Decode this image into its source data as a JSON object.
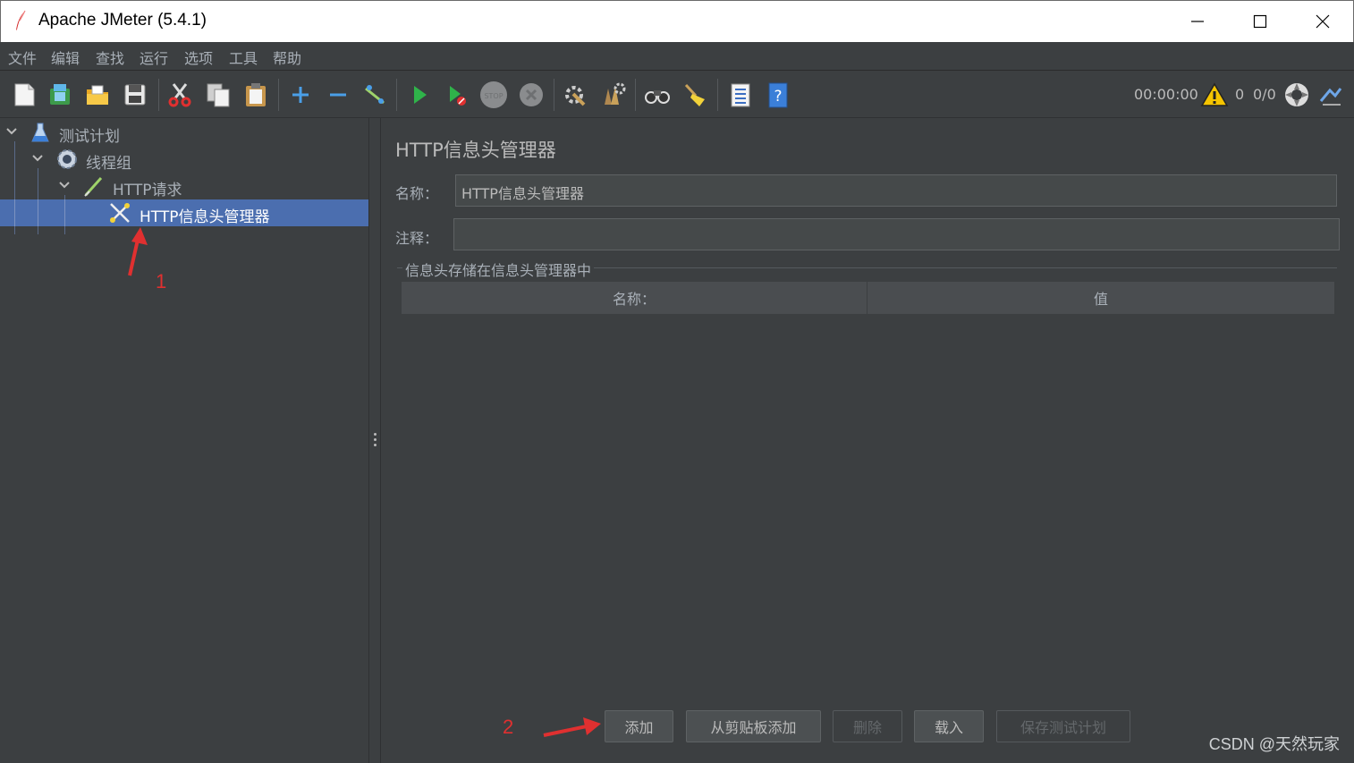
{
  "window": {
    "title": "Apache JMeter (5.4.1)"
  },
  "menu": [
    "文件",
    "编辑",
    "查找",
    "运行",
    "选项",
    "工具",
    "帮助"
  ],
  "toolbar": {
    "icons": [
      "new-icon",
      "templates-icon",
      "open-icon",
      "save-icon",
      "cut-icon",
      "copy-icon",
      "paste-icon",
      "expand-icon",
      "collapse-icon",
      "toggle-icon",
      "start-icon",
      "start-no-pauses-icon",
      "stop-icon",
      "shutdown-icon",
      "clear-icon",
      "clear-all-icon",
      "search-icon",
      "reset-search-icon",
      "function-helper-icon",
      "help-icon"
    ],
    "elapsed_time": "00:00:00",
    "warning_count": "0",
    "threads": "0/0"
  },
  "tree": {
    "nodes": [
      {
        "label": "测试计划",
        "icon": "test-plan-icon"
      },
      {
        "label": "线程组",
        "icon": "thread-group-icon"
      },
      {
        "label": "HTTP请求",
        "icon": "http-sampler-icon"
      },
      {
        "label": "HTTP信息头管理器",
        "icon": "header-manager-icon",
        "selected": true
      }
    ]
  },
  "panel": {
    "title": "HTTP信息头管理器",
    "name_label": "名称：",
    "name_value": "HTTP信息头管理器",
    "comment_label": "注释：",
    "comment_value": "",
    "group_title": "信息头存储在信息头管理器中",
    "table_headers": [
      "名称：",
      "值"
    ],
    "buttons": {
      "add": "添加",
      "add_from_clipboard": "从剪贴板添加",
      "delete": "删除",
      "load": "载入",
      "save_plan": "保存测试计划"
    }
  },
  "annotations": {
    "marker_1": "1",
    "marker_2": "2",
    "color": "#e03030"
  },
  "watermark": "CSDN @天然玩家",
  "colors": {
    "background": "#3c3f41",
    "selection": "#4b6eaf",
    "text": "#bbbbbb"
  }
}
